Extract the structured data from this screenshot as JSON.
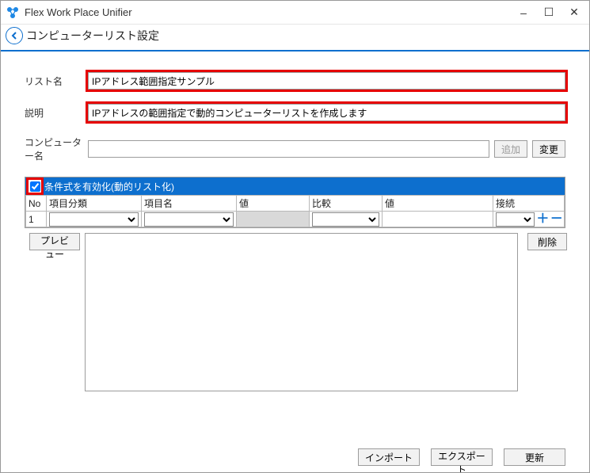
{
  "window": {
    "title": "Flex Work Place Unifier"
  },
  "page": {
    "title": "コンピューターリスト設定"
  },
  "fields": {
    "list_name_label": "リスト名",
    "list_name_value": "IPアドレス範囲指定サンプル",
    "description_label": "説明",
    "description_value": "IPアドレスの範囲指定で動的コンピューターリストを作成します",
    "computer_name_label": "コンピューター名",
    "computer_name_value": ""
  },
  "buttons": {
    "add": "追加",
    "change": "変更",
    "preview": "プレビュー",
    "delete": "削除",
    "import": "インポート",
    "export": "エクスポート",
    "update": "更新"
  },
  "condition": {
    "checkbox_checked": true,
    "header_label": "条件式を有効化(動的リスト化)",
    "columns": {
      "no": "No",
      "category": "項目分類",
      "item_name": "項目名",
      "value1": "値",
      "compare": "比較",
      "value2": "値",
      "connect": "接続"
    },
    "rows": [
      {
        "no": "1",
        "category": "",
        "item_name": "",
        "value1": "",
        "compare": "",
        "value2": "",
        "connect": ""
      }
    ]
  }
}
